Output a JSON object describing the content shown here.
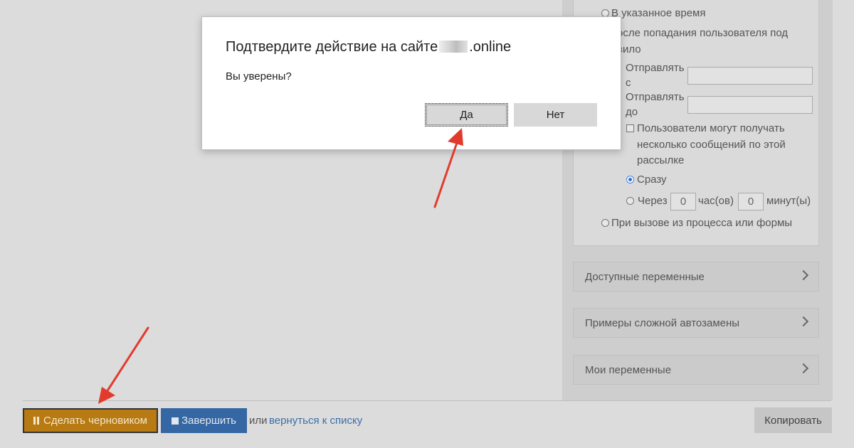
{
  "settings": {
    "radio_specified_time": "В указанное время",
    "radio_after_entering_line1": "осле попадания пользователя под",
    "radio_after_entering_line2": "вило",
    "send_from_line1": "Отправлять",
    "send_from_line2": "с",
    "send_to_line1": "Отправлять",
    "send_to_line2": "до",
    "multi_msg_line1": "Пользователи могут получать",
    "multi_msg_line2": "несколько сообщений по этой",
    "multi_msg_line3": "рассылке",
    "radio_immediately": "Сразу",
    "radio_after": "Через",
    "hours_value": "0",
    "hours_unit": "час(ов)",
    "minutes_value": "0",
    "minutes_unit": "минут(ы)",
    "radio_on_call": "При вызове из процесса или формы"
  },
  "accordions": [
    {
      "label": "Доступные переменные"
    },
    {
      "label": "Примеры сложной автозамены"
    },
    {
      "label": "Мои переменные"
    }
  ],
  "bottom_bar": {
    "draft_label": "Сделать черновиком",
    "finish_label": "Завершить",
    "or_text": "или",
    "back_link": "вернуться к списку",
    "copy_label": "Копировать"
  },
  "dialog": {
    "title_prefix": "Подтвердите действие на сайте",
    "title_suffix": ".online",
    "message": "Вы уверены?",
    "yes_label": "Да",
    "no_label": "Нет"
  },
  "colors": {
    "draft_button": "#b87a12",
    "finish_button": "#3467a3",
    "annotation_arrow": "#e23b2e",
    "link": "#3c6fa8"
  },
  "icons": {
    "draft": "pause-icon",
    "finish": "stop-icon",
    "accordion": "chevron-right-icon"
  }
}
